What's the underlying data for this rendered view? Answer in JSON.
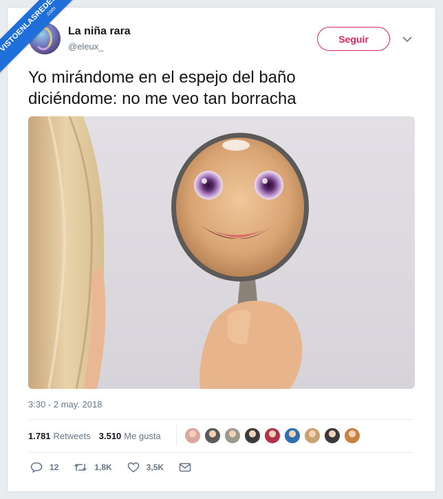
{
  "watermark": {
    "line1": "VISTOENLASREDES",
    "line2": ".com"
  },
  "author": {
    "name": "La niña rara",
    "handle": "@eleux_"
  },
  "follow_label": "Seguir",
  "tweet": {
    "line1": "Yo mirándome en el espejo del baño",
    "line2": "diciéndome: no me veo tan borracha"
  },
  "timestamp": "3:30 - 2 may. 2018",
  "stats": {
    "retweets_count": "1.781",
    "retweets_label": "Retweets",
    "likes_count": "3.510",
    "likes_label": "Me gusta"
  },
  "liker_colors": [
    "#d9a6a0",
    "#5a5a5a",
    "#9a9a8e",
    "#3b3b3b",
    "#b2324a",
    "#2d6fb0",
    "#c9a070",
    "#3a3a3a",
    "#c98040"
  ],
  "actions": {
    "replies": "12",
    "retweets": "1,8K",
    "likes": "3,5K"
  },
  "colors": {
    "accent": "#e0245e",
    "muted": "#657786",
    "watermark": "#1e6fd9"
  }
}
